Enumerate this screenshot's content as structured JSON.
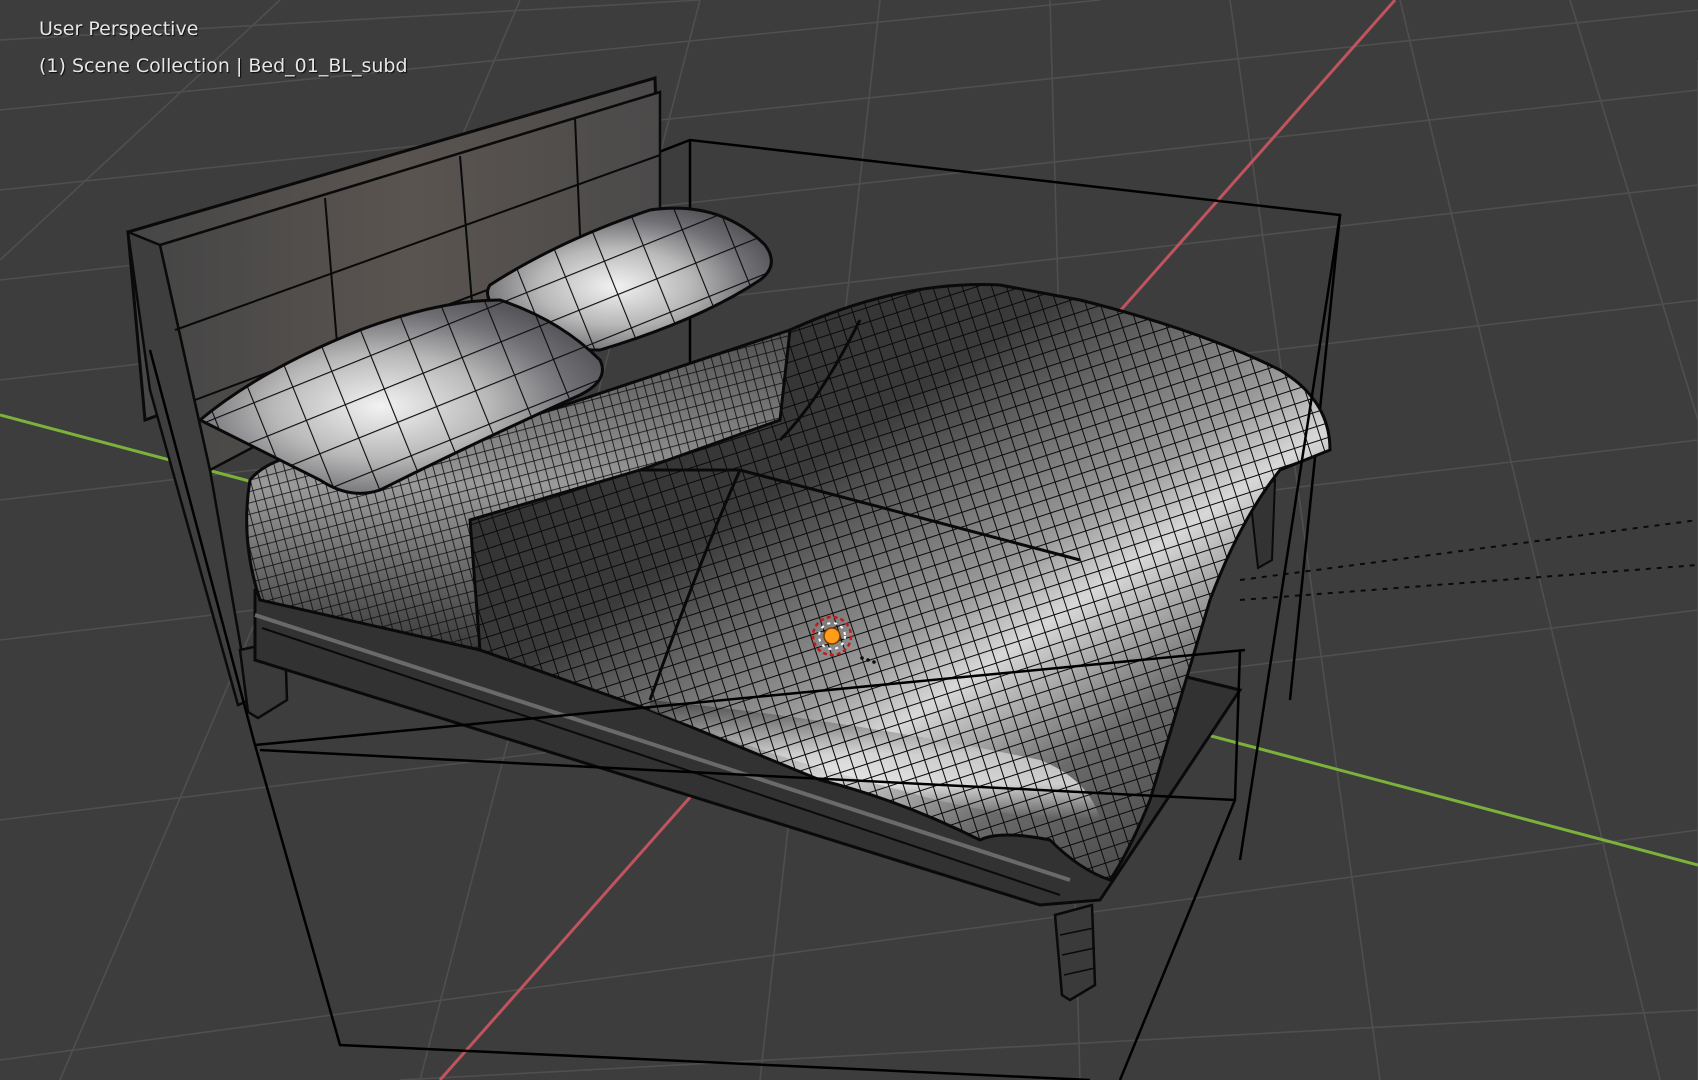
{
  "viewport": {
    "view_name": "User Perspective",
    "collection_info": "(1) Scene Collection | Bed_01_BL_subd",
    "active_object": "Bed_01_BL_subd",
    "shading": "solid-with-wireframe",
    "colors": {
      "background": "#3d3d3d",
      "grid_line": "#4c4c4c",
      "x_axis": "#c0545e",
      "y_axis": "#7cb23a",
      "bounding_box": "#000000",
      "origin_dot": "#ff9c1a"
    }
  },
  "icons": {
    "light": "light-source-icon",
    "origin": "object-origin-icon"
  }
}
